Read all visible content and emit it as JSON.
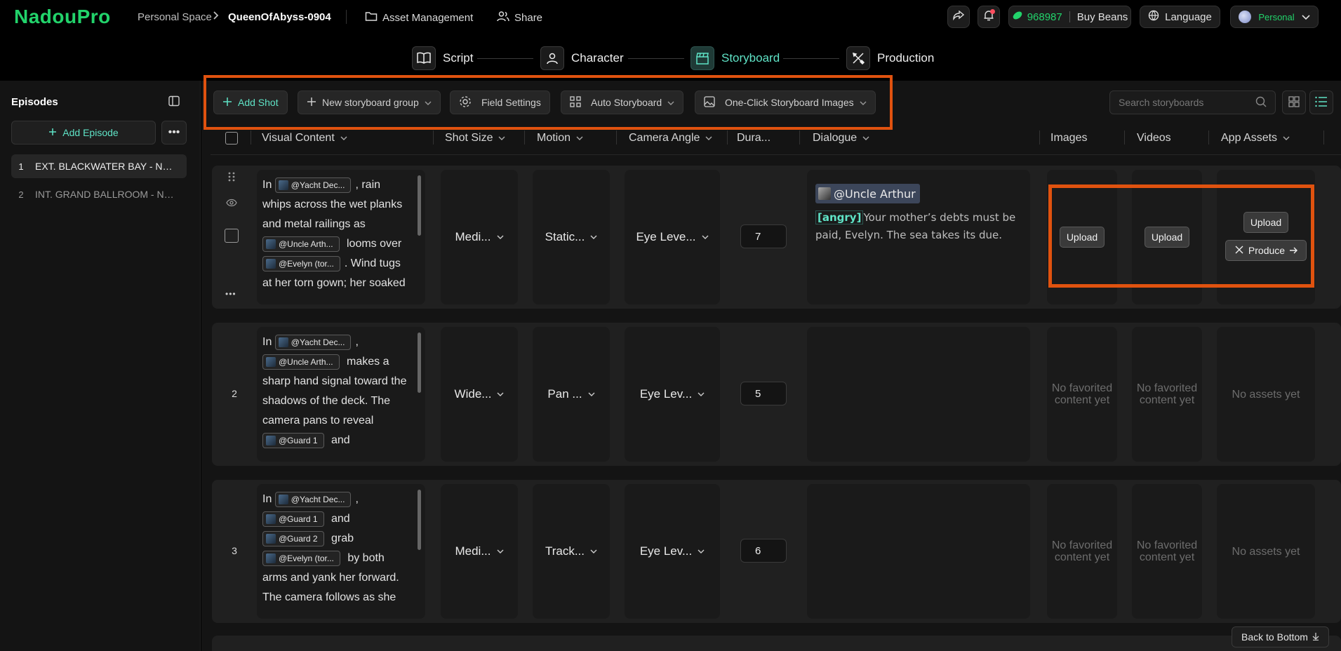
{
  "app": {
    "logo": "NadouPro"
  },
  "header": {
    "breadcrumb_space": "Personal Space",
    "breadcrumb_project": "QueenOfAbyss-0904",
    "asset_management": "Asset Management",
    "share": "Share",
    "beans_count": "968987",
    "buy_beans": "Buy Beans",
    "language": "Language",
    "account": "Personal"
  },
  "steps": [
    {
      "label": "Script"
    },
    {
      "label": "Character"
    },
    {
      "label": "Storyboard"
    },
    {
      "label": "Production"
    }
  ],
  "sidebar": {
    "title": "Episodes",
    "add_episode": "Add Episode",
    "episodes": [
      {
        "num": "1",
        "title": "EXT. BLACKWATER BAY - NIGHT",
        "active": true
      },
      {
        "num": "2",
        "title": "INT. GRAND BALLROOM - NIGHT",
        "active": false
      }
    ]
  },
  "toolbar": {
    "add_shot": "Add Shot",
    "new_group": "New storyboard group",
    "field_settings": "Field Settings",
    "auto_storyboard": "Auto Storyboard",
    "one_click_images": "One-Click Storyboard Images",
    "search_placeholder": "Search storyboards"
  },
  "columns": {
    "visual": "Visual Content",
    "shot_size": "Shot Size",
    "motion": "Motion",
    "camera_angle": "Camera Angle",
    "duration": "Dura...",
    "dialogue": "Dialogue",
    "images": "Images",
    "videos": "Videos",
    "app_assets": "App Assets"
  },
  "shots": [
    {
      "num": "",
      "visual": {
        "p1": "In",
        "t1": "@Yacht Dec...",
        "p2": ", rain whips across the wet planks and metal railings as",
        "t2": "@Uncle Arth...",
        "p3": "looms over",
        "t3": "@Evelyn (tor...",
        "p4": ". Wind tugs at her torn gown; her soaked"
      },
      "shot_size": "Medi...",
      "motion": "Static...",
      "camera_angle": "Eye Leve...",
      "duration": "7",
      "dialogue_speaker": "@Uncle Arthur",
      "dialogue_emotion": "[angry]",
      "dialogue_text": "Your mother’s debts must be paid, Evelyn. The sea takes its due.",
      "images": "Upload",
      "videos": "Upload",
      "assets_upload": "Upload",
      "assets_produce": "Produce"
    },
    {
      "num": "2",
      "visual": {
        "p1": "In",
        "t1": "@Yacht Dec...",
        "p2": ",",
        "t2": "@Uncle Arth...",
        "p3": "makes a sharp hand signal toward the shadows of the deck. The camera pans to reveal",
        "t3": "@Guard 1",
        "p4": "and"
      },
      "shot_size": "Wide...",
      "motion": "Pan ...",
      "camera_angle": "Eye Lev...",
      "duration": "5",
      "images_empty": "No favorited content yet",
      "videos_empty": "No favorited content yet",
      "assets_empty": "No assets yet"
    },
    {
      "num": "3",
      "visual": {
        "p1": "In",
        "t1": "@Yacht Dec...",
        "p2": ",",
        "t2": "@Guard 1",
        "p3": "and",
        "t3": "@Guard 2",
        "p4": "grab",
        "t4": "@Evelyn (tor...",
        "p5": "by both arms and yank her forward. The camera follows as she"
      },
      "shot_size": "Medi...",
      "motion": "Track...",
      "camera_angle": "Eye Lev...",
      "duration": "6",
      "images_empty": "No favorited content yet",
      "videos_empty": "No favorited content yet",
      "assets_empty": "No assets yet"
    }
  ],
  "back_to_bottom": "Back to Bottom",
  "colors": {
    "brand": "#22d36b",
    "accent": "#5fe3c6",
    "highlight_frame": "#e0520f"
  }
}
